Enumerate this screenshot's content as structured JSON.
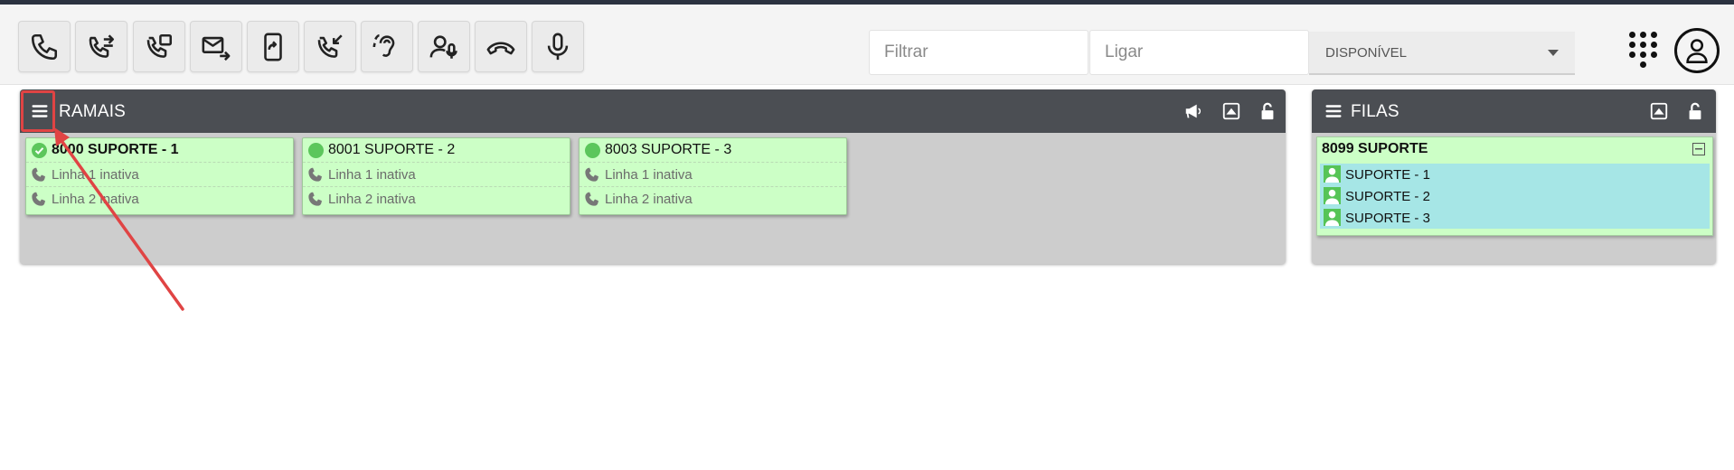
{
  "toolbar": {
    "buttons": [
      {
        "name": "call-icon"
      },
      {
        "name": "transfer-call-icon"
      },
      {
        "name": "attended-transfer-icon"
      },
      {
        "name": "voicemail-forward-icon"
      },
      {
        "name": "mobile-forward-icon"
      },
      {
        "name": "incoming-call-icon"
      },
      {
        "name": "listen-icon"
      },
      {
        "name": "user-mic-icon"
      },
      {
        "name": "hangup-icon"
      },
      {
        "name": "microphone-icon"
      }
    ],
    "filter_placeholder": "Filtrar",
    "dial_placeholder": "Ligar",
    "status_value": "DISPONÍVEL"
  },
  "ramais": {
    "title": "RAMAIS",
    "extensions": [
      {
        "title": "8000 SUPORTE - 1",
        "status": "check",
        "line1": "Linha 1 inativa",
        "line2": "Linha 2 inativa"
      },
      {
        "title": "8001 SUPORTE - 2",
        "status": "dot",
        "line1": "Linha 1 inativa",
        "line2": "Linha 2 inativa"
      },
      {
        "title": "8003 SUPORTE - 3",
        "status": "dot",
        "line1": "Linha 1 inativa",
        "line2": "Linha 2 inativa"
      }
    ]
  },
  "filas": {
    "title": "FILAS",
    "queue": {
      "title": "8099 SUPORTE",
      "agents": [
        "SUPORTE - 1",
        "SUPORTE - 2",
        "SUPORTE - 3"
      ]
    }
  },
  "colors": {
    "header": "#4b4e53",
    "card_green": "#ccffc6",
    "agent_cyan": "#a6e6e6",
    "annotation_red": "#e04444"
  }
}
